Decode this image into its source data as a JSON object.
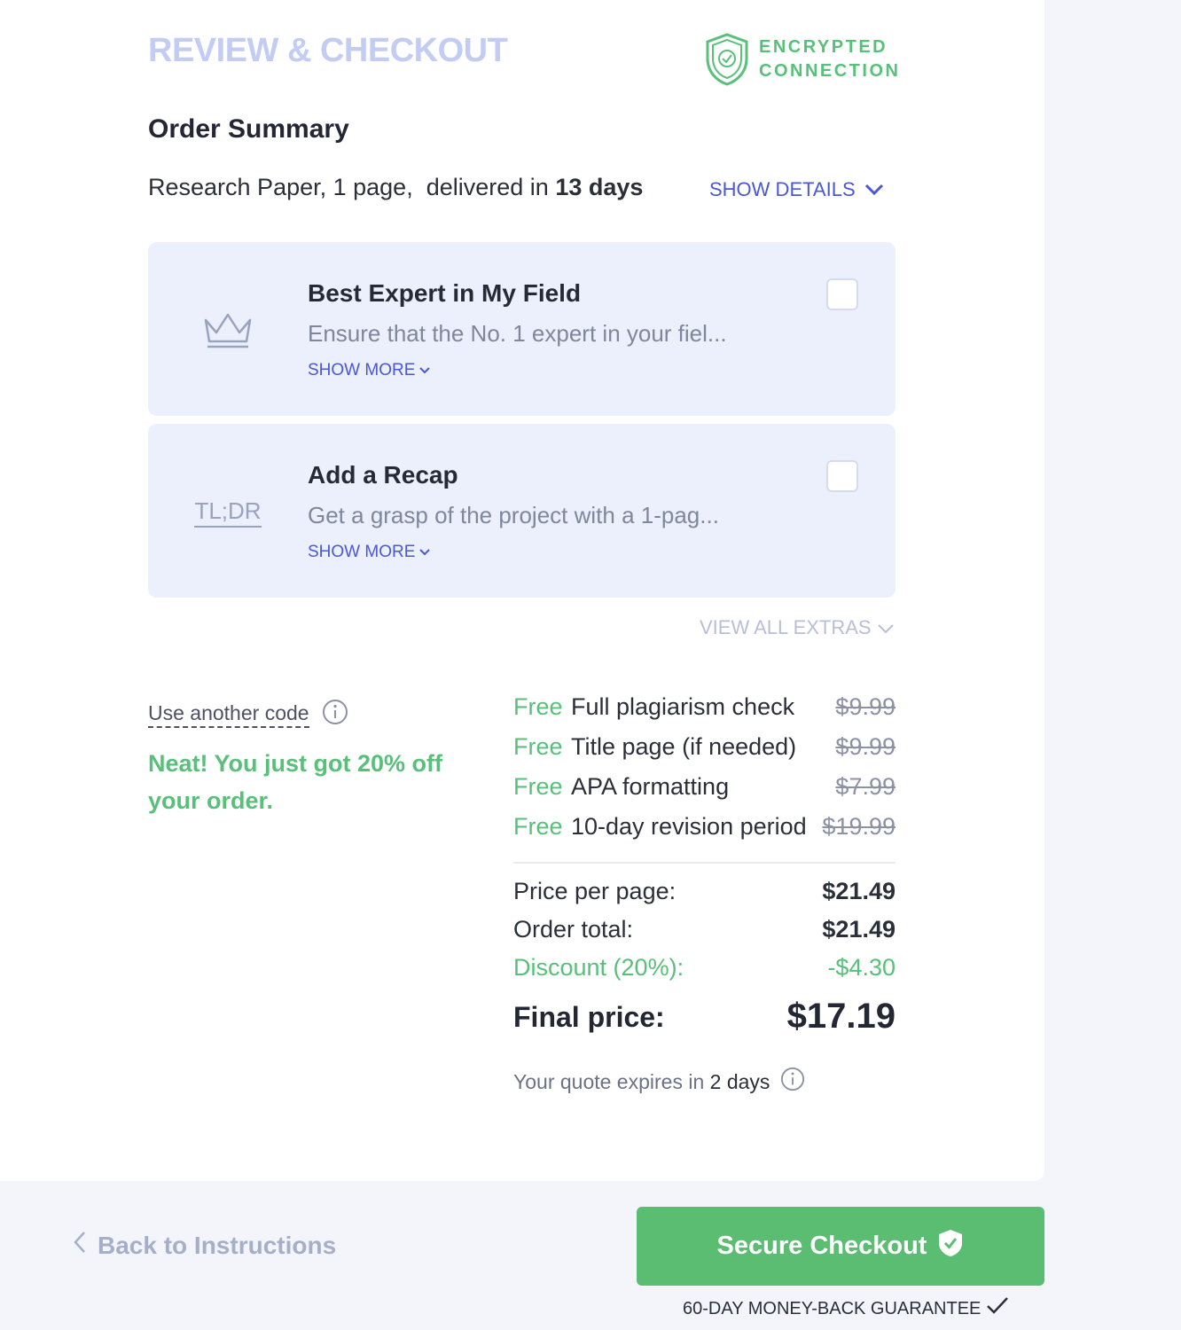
{
  "header": {
    "title": "REVIEW & CHECKOUT",
    "secure_line1": "ENCRYPTED",
    "secure_line2": "CONNECTION"
  },
  "summary": {
    "title": "Order Summary",
    "order_desc": "Research Paper, 1 page,",
    "delivered_prefix": "delivered in",
    "delivered_days": "13 days",
    "show_details": "SHOW DETAILS"
  },
  "extras": [
    {
      "icon": "crown-icon",
      "title": "Best Expert in My Field",
      "desc": "Ensure that the No. 1 expert in your fiel...",
      "more": "SHOW MORE",
      "checked": false
    },
    {
      "icon": "tldr-icon",
      "icon_text": "TL;DR",
      "title": "Add a Recap",
      "desc": "Get a grasp of the project with a 1-pag...",
      "more": "SHOW MORE",
      "checked": false
    }
  ],
  "view_all_extras": "VIEW ALL EXTRAS",
  "promo": {
    "link": "Use another code",
    "message": "Neat! You just got 20% off your order."
  },
  "freebies": [
    {
      "free": "Free",
      "label": "Full plagiarism check",
      "old_price": "$9.99"
    },
    {
      "free": "Free",
      "label": "Title page (if needed)",
      "old_price": "$9.99"
    },
    {
      "free": "Free",
      "label": "APA formatting",
      "old_price": "$7.99"
    },
    {
      "free": "Free",
      "label": "10-day revision period",
      "old_price": "$19.99"
    }
  ],
  "pricing": {
    "price_per_page_label": "Price per page:",
    "price_per_page": "$21.49",
    "order_total_label": "Order total:",
    "order_total": "$21.49",
    "discount_label": "Discount (20%):",
    "discount": "-$4.30",
    "final_label": "Final price:",
    "final": "$17.19"
  },
  "expires": {
    "prefix": "Your quote expires in",
    "value": "2 days"
  },
  "footer": {
    "back": "Back to Instructions",
    "checkout": "Secure Checkout",
    "guarantee": "60-DAY MONEY-BACK GUARANTEE"
  },
  "colors": {
    "accent_green": "#58c07a",
    "button_green": "#5bbd72",
    "link_blue": "#4a57d6",
    "title_muted": "#c3cdf3",
    "card_tint": "#ebf0fc"
  }
}
